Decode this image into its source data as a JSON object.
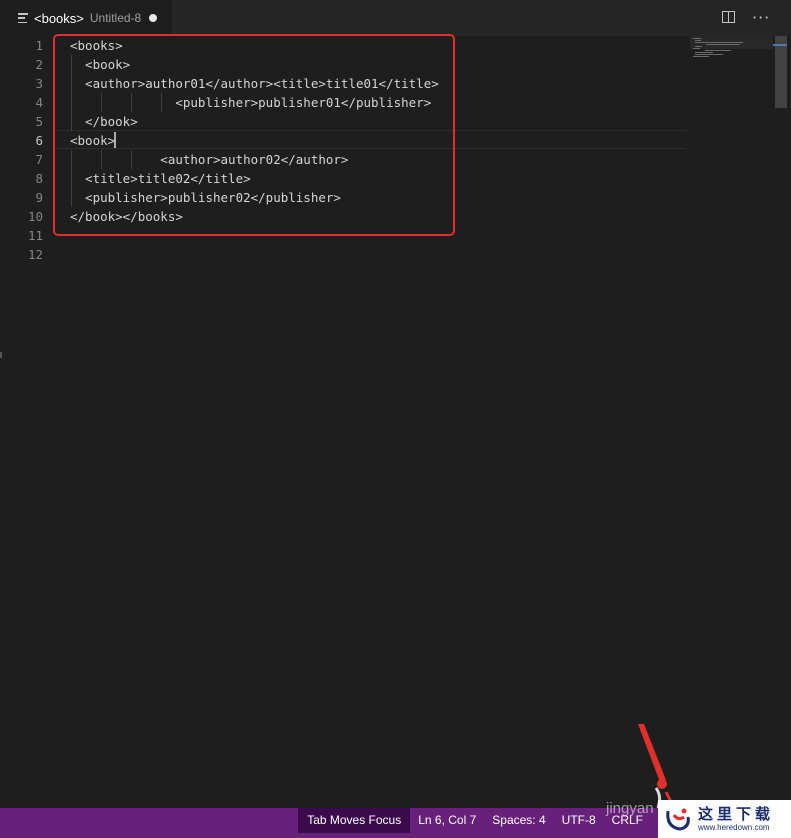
{
  "tab": {
    "title": "<books>",
    "description": "Untitled-8",
    "icon": "file-lines-icon",
    "modified": true
  },
  "editor_actions": {
    "split_icon": "split-editor-icon",
    "more_icon": "more-actions-icon",
    "more_glyph": "···"
  },
  "editor": {
    "active_line": 6,
    "line_numbers": [
      "1",
      "2",
      "3",
      "4",
      "5",
      "6",
      "7",
      "8",
      "9",
      "10",
      "11",
      "12"
    ],
    "lines": [
      "<books>",
      "  <book>",
      "  <author>author01</author><title>title01</title>",
      "              <publisher>publisher01</publisher>",
      "  </book>",
      "<book>",
      "            <author>author02</author>",
      "  <title>title02</title>",
      "  <publisher>publisher02</publisher>",
      "</book></books>",
      "",
      ""
    ]
  },
  "statusbar": {
    "tab_focus": "Tab Moves Focus",
    "cursor_position": "Ln 6, Col 7",
    "indentation": "Spaces: 4",
    "encoding": "UTF-8",
    "eol": "CRLF"
  },
  "watermark": {
    "text": "jingyan",
    "logo_cn": "这里下载",
    "logo_url": "www.heredown.com"
  },
  "colors": {
    "editor_bg": "#1e1e1e",
    "statusbar_bg": "#68217a",
    "highlight_red": "#e1302b"
  }
}
